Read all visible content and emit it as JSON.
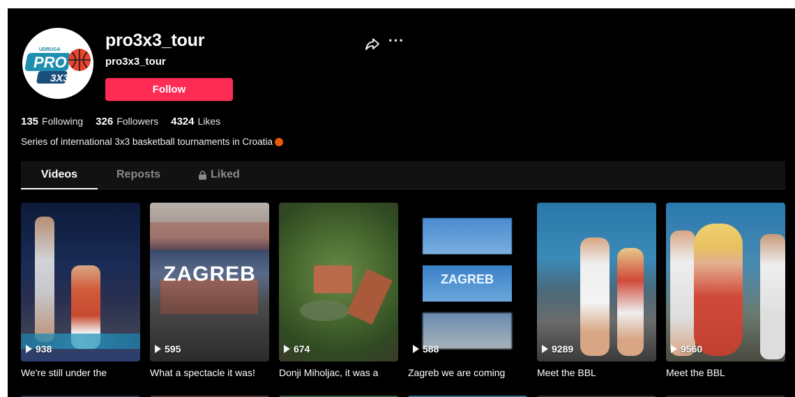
{
  "profile": {
    "username": "pro3x3_tour",
    "handle": "pro3x3_tour",
    "follow_label": "Follow",
    "avatar_logo": {
      "top_text": "UDRUGA",
      "main_text": "PRO",
      "sub_text": "3X3"
    },
    "stats": [
      {
        "value": "135",
        "label": "Following"
      },
      {
        "value": "326",
        "label": "Followers"
      },
      {
        "value": "4324",
        "label": "Likes"
      }
    ],
    "bio": "Series of international 3x3 basketball tournaments in Croatia"
  },
  "tabs": [
    {
      "label": "Videos",
      "active": true
    },
    {
      "label": "Reposts",
      "active": false
    },
    {
      "label": "Liked",
      "active": false,
      "icon": "lock-icon"
    }
  ],
  "videos": [
    {
      "views": "938",
      "caption": "We're still under the"
    },
    {
      "views": "595",
      "caption": "What a spectacle it was!",
      "overlay_text": "ZAGREB"
    },
    {
      "views": "674",
      "caption": "Donji Miholjac, it was a"
    },
    {
      "views": "588",
      "caption": "Zagreb we are coming",
      "overlay_text": "ZAGREB"
    },
    {
      "views": "9289",
      "caption": "Meet the BBL"
    },
    {
      "views": "9560",
      "caption": "Meet the BBL"
    }
  ],
  "colors": {
    "accent": "#fe2c55",
    "background": "#000000",
    "tab_bar": "#121212"
  }
}
